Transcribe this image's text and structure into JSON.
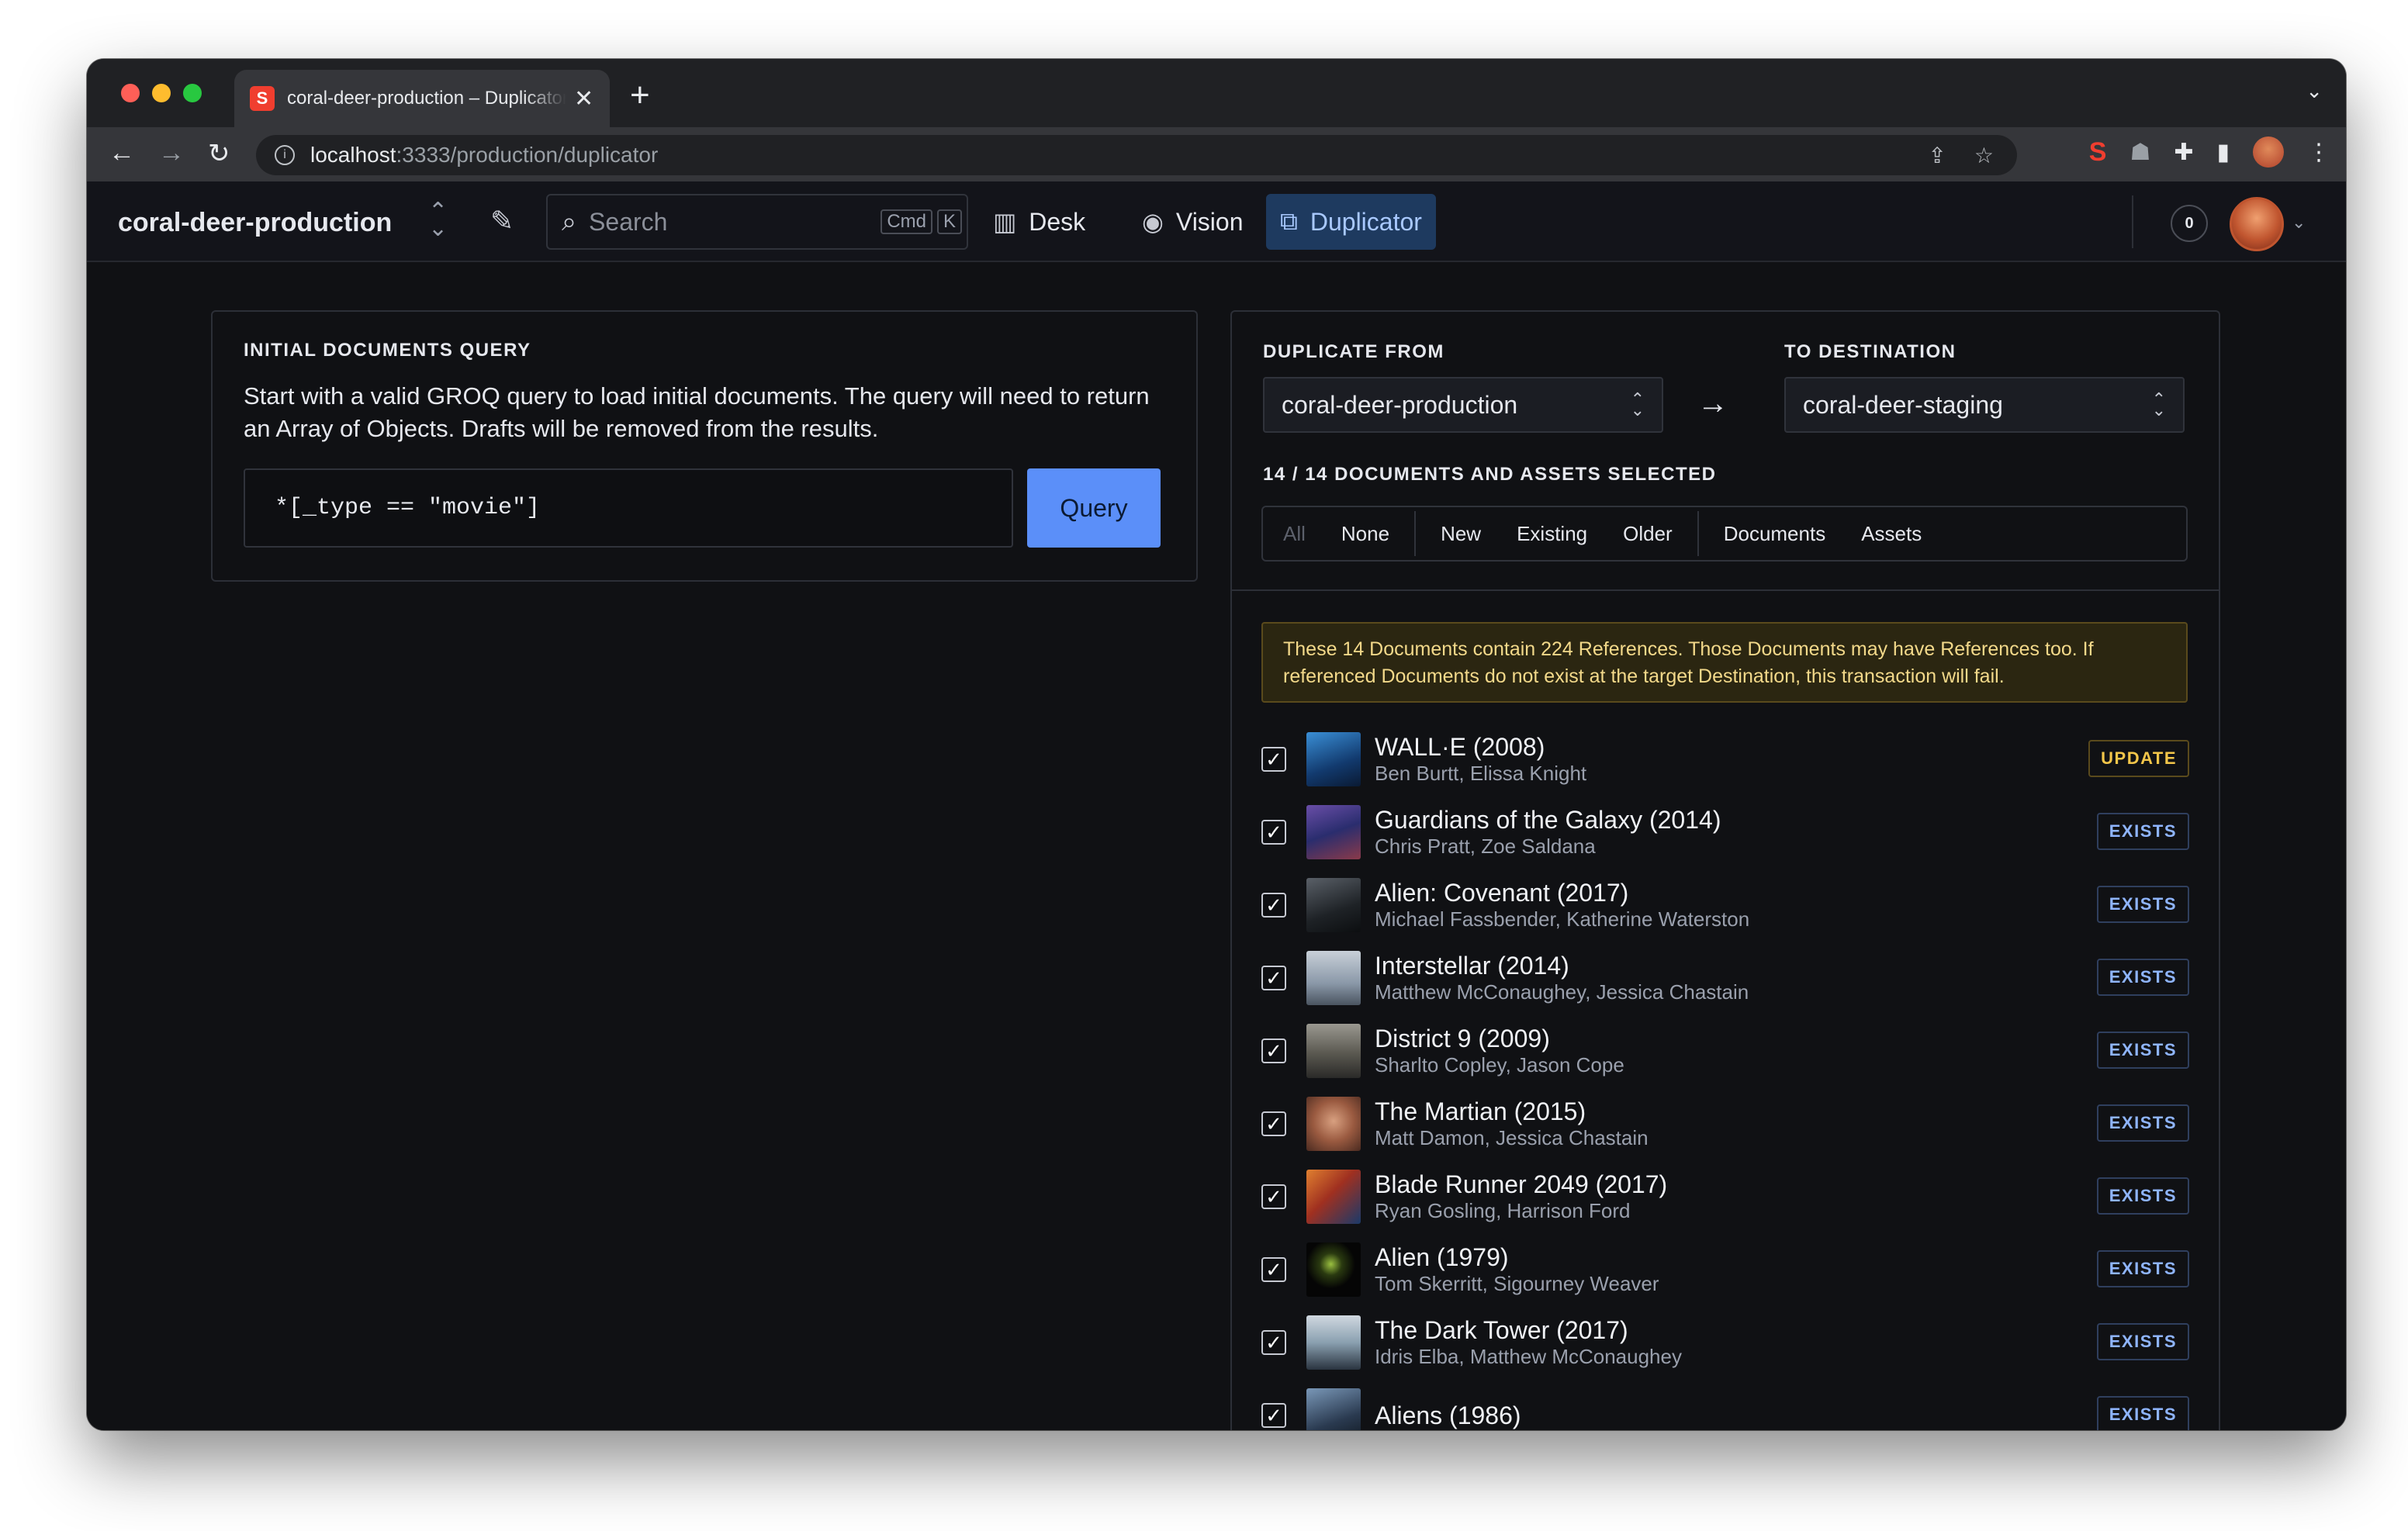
{
  "browser": {
    "tab_title": "coral-deer-production – Duplicator",
    "tab_close": "✕",
    "new_tab": "+",
    "address_host": "localhost",
    "address_path": ":3333/production/duplicator"
  },
  "studio": {
    "project_name": "coral-deer-production",
    "search_placeholder": "Search",
    "kbd_cmd": "Cmd",
    "kbd_k": "K",
    "tools": [
      {
        "label": "Desk"
      },
      {
        "label": "Vision"
      },
      {
        "label": "Duplicator"
      }
    ],
    "notifications_count": "0"
  },
  "left_card": {
    "heading": "INITIAL DOCUMENTS QUERY",
    "description": "Start with a valid GROQ query to load initial documents. The query will need to return an Array of Objects. Drafts will be removed from the results.",
    "query_value": "*[_type == \"movie\"]",
    "query_button": "Query"
  },
  "right_panel": {
    "from_label": "DUPLICATE FROM",
    "to_label": "TO DESTINATION",
    "from_value": "coral-deer-production",
    "to_value": "coral-deer-staging",
    "selected_count": "14 / 14 DOCUMENTS AND ASSETS SELECTED",
    "filters": [
      "All",
      "None",
      "New",
      "Existing",
      "Older",
      "Documents",
      "Assets"
    ],
    "warning": "These 14 Documents contain 224 References. Those Documents may have References too. If referenced Documents do not exist at the target Destination, this transaction will fail.",
    "documents": [
      {
        "title": "WALL·E (2008)",
        "cast": "Ben Burtt, Elissa Knight",
        "status": "UPDATE"
      },
      {
        "title": "Guardians of the Galaxy (2014)",
        "cast": "Chris Pratt, Zoe Saldana",
        "status": "EXISTS"
      },
      {
        "title": "Alien: Covenant (2017)",
        "cast": "Michael Fassbender, Katherine Waterston",
        "status": "EXISTS"
      },
      {
        "title": "Interstellar (2014)",
        "cast": "Matthew McConaughey, Jessica Chastain",
        "status": "EXISTS"
      },
      {
        "title": "District 9 (2009)",
        "cast": "Sharlto Copley, Jason Cope",
        "status": "EXISTS"
      },
      {
        "title": "The Martian (2015)",
        "cast": "Matt Damon, Jessica Chastain",
        "status": "EXISTS"
      },
      {
        "title": "Blade Runner 2049 (2017)",
        "cast": "Ryan Gosling, Harrison Ford",
        "status": "EXISTS"
      },
      {
        "title": "Alien (1979)",
        "cast": "Tom Skerritt, Sigourney Weaver",
        "status": "EXISTS"
      },
      {
        "title": "The Dark Tower (2017)",
        "cast": "Idris Elba, Matthew McConaughey",
        "status": "EXISTS"
      },
      {
        "title": "Aliens (1986)",
        "cast": "",
        "status": "EXISTS"
      }
    ]
  }
}
